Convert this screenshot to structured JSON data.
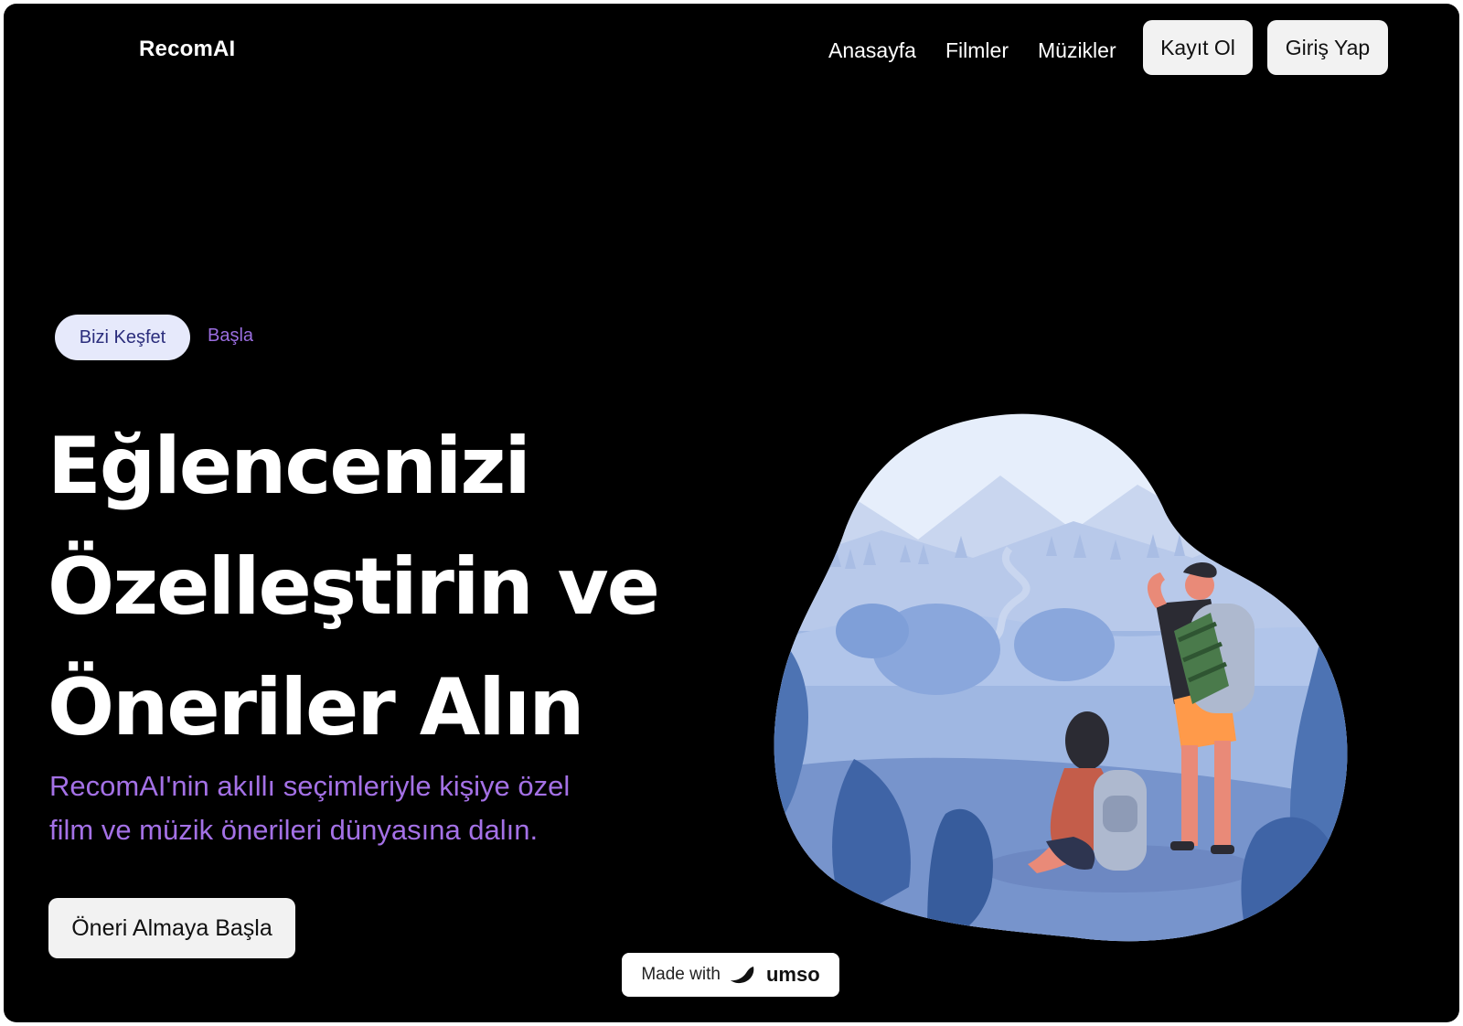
{
  "header": {
    "logo": "RecomAI",
    "nav": [
      "Anasayfa",
      "Filmler",
      "Müzikler"
    ],
    "register_label": "Kayıt Ol",
    "login_label": "Giriş Yap"
  },
  "hero": {
    "pill_label": "Bizi Keşfet",
    "pill_link": "Başla",
    "headline_lines": [
      "Eğlencenizi",
      "Özelleştirin ve",
      "Öneriler Alın"
    ],
    "subtitle_lines": [
      "RecomAI'nin akıllı seçimleriyle kişiye özel",
      "film ve müzik önerileri dünyasına dalın."
    ],
    "cta_label": "Öneri Almaya Başla"
  },
  "badge": {
    "prefix": "Made with",
    "brand": "umso",
    "icon": "umso-logo-icon"
  },
  "colors": {
    "background": "#000000",
    "accent_purple": "#a471e6",
    "pill_bg": "#e6e9fb",
    "pill_text": "#2b2d7c",
    "button_bg": "#f2f2f2"
  },
  "illustration": {
    "icon": "hikers-landscape-illustration"
  }
}
